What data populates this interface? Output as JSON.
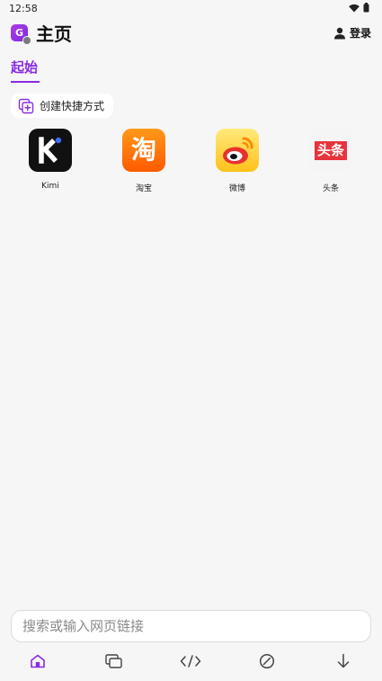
{
  "status": {
    "time": "12:58"
  },
  "header": {
    "title": "主页",
    "app_icon_letter": "G",
    "login_label": "登录"
  },
  "tabs": [
    {
      "label": "起始",
      "active": true
    }
  ],
  "create_shortcut": {
    "label": "创建快捷方式"
  },
  "shortcuts": [
    {
      "label": "Kimi",
      "icon": "kimi-icon"
    },
    {
      "label": "淘宝",
      "icon": "taobao-icon",
      "glyph": "淘"
    },
    {
      "label": "微博",
      "icon": "weibo-icon"
    },
    {
      "label": "头条",
      "icon": "toutiao-icon",
      "glyph": "头条"
    }
  ],
  "search": {
    "placeholder": "搜索或输入网页链接",
    "value": ""
  },
  "bottom_nav": [
    {
      "icon": "home-icon",
      "active": true
    },
    {
      "icon": "tabs-icon"
    },
    {
      "icon": "code-icon"
    },
    {
      "icon": "block-icon"
    },
    {
      "icon": "download-icon"
    }
  ],
  "colors": {
    "accent": "#8a2be2",
    "background": "#f6f6f6"
  }
}
